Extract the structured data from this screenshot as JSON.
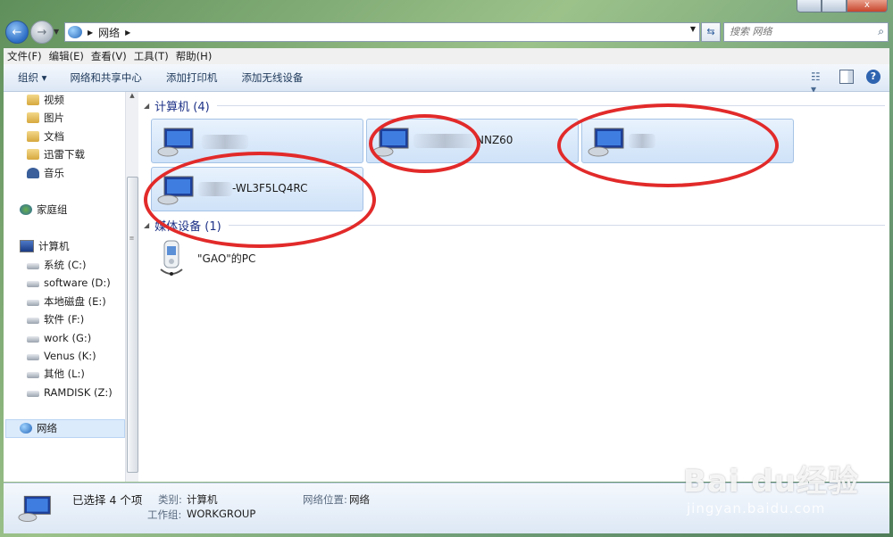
{
  "window": {
    "close_glyph": "x"
  },
  "nav": {
    "back_glyph": "←",
    "forward_glyph": "→"
  },
  "address": {
    "crumb": "网络"
  },
  "search": {
    "placeholder": "搜索 网络"
  },
  "menubar": [
    {
      "label": "文件(F)"
    },
    {
      "label": "编辑(E)"
    },
    {
      "label": "查看(V)"
    },
    {
      "label": "工具(T)"
    },
    {
      "label": "帮助(H)"
    }
  ],
  "toolbar": {
    "organize": "组织 ▾",
    "network_center": "网络和共享中心",
    "add_printer": "添加打印机",
    "add_wireless": "添加无线设备",
    "help_glyph": "?"
  },
  "sidebar": {
    "libraries": [
      "视频",
      "图片",
      "文档",
      "迅雷下载",
      "音乐"
    ],
    "homegroup": "家庭组",
    "computer": "计算机",
    "drives": [
      "系统 (C:)",
      "software (D:)",
      "本地磁盘 (E:)",
      "软件 (F:)",
      "work (G:)",
      "Venus (K:)",
      "其他 (L:)",
      "RAMDISK (Z:)"
    ],
    "network": "网络"
  },
  "groups": {
    "computers_header": "计算机 (4)",
    "media_header": "媒体设备 (1)"
  },
  "computers": [
    {
      "name": ""
    },
    {
      "name": "NNZ60"
    },
    {
      "name": ""
    },
    {
      "name": "-WL3F5LQ4RC"
    }
  ],
  "media": {
    "name": "\"GAO\"的PC"
  },
  "details": {
    "selected": "已选择 4 个项",
    "category_label": "类别:",
    "category_value": "计算机",
    "location_label": "网络位置:",
    "location_value": "网络",
    "workgroup_label": "工作组:",
    "workgroup_value": "WORKGROUP"
  },
  "watermark": {
    "main": "Bai du经验",
    "sub": "jingyan.baidu.com"
  },
  "colors": {
    "annotation_ring": "#e22a2a",
    "group_header": "#1e3287"
  }
}
